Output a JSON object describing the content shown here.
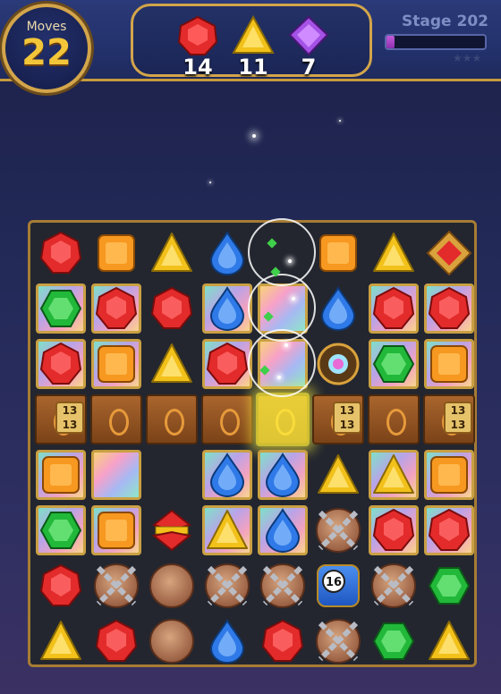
{
  "hud": {
    "moves_label": "Moves",
    "moves_value": "22",
    "stage_label": "Stage 202",
    "stage_progress": 0.08,
    "stars_text": "★★★",
    "goals": [
      {
        "gem": "red",
        "count": "14"
      },
      {
        "gem": "yellow",
        "count": "11"
      },
      {
        "gem": "purple",
        "count": "7"
      }
    ]
  },
  "colors": {
    "red": "#e32b2b",
    "orange": "#f79820",
    "yellow": "#f2c11a",
    "blue": "#2f7ae8",
    "green": "#22b83a",
    "purple": "#a452e6",
    "frame_gold": "#c9a043"
  },
  "board": {
    "bomb_counter": "16",
    "chest_lock_text": "13",
    "rows": [
      [
        "red",
        "orange",
        "yellow",
        "blue",
        "empty",
        "orange",
        "yellow",
        "special-red"
      ],
      [
        "glass-green",
        "glass-red",
        "red",
        "glass-blue",
        "glass-rainbow",
        "blue",
        "glass-red",
        "glass-red"
      ],
      [
        "glass-red",
        "glass-orange",
        "yellow",
        "glass-red",
        "glass-rainbow",
        "orb",
        "glass-green",
        "glass-orange"
      ],
      [
        "chest",
        "plank",
        "plank",
        "plank",
        "glow",
        "chest",
        "plank",
        "chest"
      ],
      [
        "glass-orange",
        "glass-rainbow",
        "empty",
        "glass-blue",
        "glass-blue",
        "yellow",
        "glass-yellow",
        "glass-orange"
      ],
      [
        "glass-green",
        "glass-orange",
        "striped-red",
        "glass-yellow",
        "glass-blue",
        "chain",
        "glass-red",
        "glass-red"
      ],
      [
        "red",
        "chain",
        "token",
        "chain",
        "chain",
        "bomb",
        "chain",
        "green"
      ],
      [
        "yellow",
        "red",
        "token",
        "blue",
        "red",
        "chain",
        "green",
        "yellow"
      ]
    ]
  }
}
